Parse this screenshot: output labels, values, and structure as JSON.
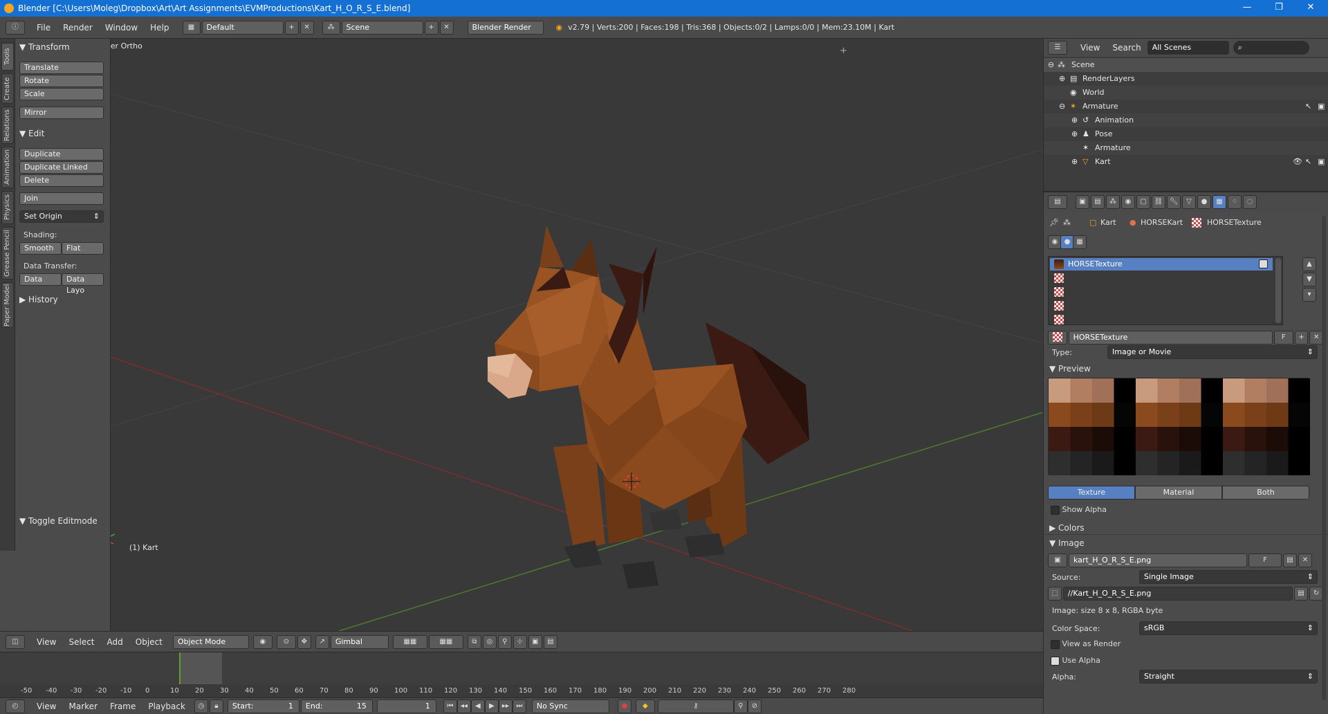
{
  "titlebar": {
    "title": "Blender [C:\\Users\\Moleg\\Dropbox\\Art\\Art Assignments\\EVMProductions\\Kart_H_O_R_S_E.blend]",
    "minimize": "—",
    "maximize": "❐",
    "close": "✕"
  },
  "info": {
    "menus": [
      "File",
      "Render",
      "Window",
      "Help"
    ],
    "layout": "Default",
    "scene": "Scene",
    "engine": "Blender Render",
    "stats": "v2.79 | Verts:200 | Faces:198 | Tris:368 | Objects:0/2 | Lamps:0/0 | Mem:23.10M | Kart"
  },
  "tabs": [
    "Tools",
    "Create",
    "Relations",
    "Animation",
    "Physics",
    "Grease Pencil",
    "Paper Model"
  ],
  "toolshelf": {
    "transform_header": "Transform",
    "translate": "Translate",
    "rotate": "Rotate",
    "scale": "Scale",
    "mirror": "Mirror",
    "edit_header": "Edit",
    "duplicate": "Duplicate",
    "duplicate_linked": "Duplicate Linked",
    "delete": "Delete",
    "join": "Join",
    "set_origin": "Set Origin",
    "shading_label": "Shading:",
    "smooth": "Smooth",
    "flat": "Flat",
    "data_transfer_label": "Data Transfer:",
    "data": "Data",
    "data_layo": "Data Layo",
    "history_header": "History",
    "toggle_editmode": "Toggle Editmode"
  },
  "viewport": {
    "view_label": "User Ortho",
    "object_label": "(1) Kart"
  },
  "view3d_header": {
    "menus": [
      "View",
      "Select",
      "Add",
      "Object"
    ],
    "mode": "Object Mode",
    "orientation": "Gimbal"
  },
  "timeline": {
    "ticks": [
      "-50",
      "-40",
      "-30",
      "-20",
      "-10",
      "0",
      "10",
      "20",
      "30",
      "40",
      "50",
      "60",
      "70",
      "80",
      "90",
      "100",
      "110",
      "120",
      "130",
      "140",
      "150",
      "160",
      "170",
      "180",
      "190",
      "200",
      "210",
      "220",
      "230",
      "240",
      "250",
      "260",
      "270",
      "280"
    ],
    "menus": [
      "View",
      "Marker",
      "Frame",
      "Playback"
    ],
    "start_label": "Start:",
    "start": "1",
    "end_label": "End:",
    "end": "15",
    "current": "1",
    "sync": "No Sync"
  },
  "outliner": {
    "menus": [
      "View",
      "Search"
    ],
    "filter": "All Scenes",
    "rows": [
      "Scene",
      "RenderLayers",
      "World",
      "Armature",
      "Animation",
      "Pose",
      "Armature",
      "Kart"
    ]
  },
  "properties": {
    "breadcrumb": [
      "Kart",
      "HORSEKart",
      "HORSETexture"
    ],
    "slots": [
      "HORSETexture"
    ],
    "texture_name": "HORSETexture",
    "fake_user": "F",
    "type_label": "Type:",
    "type_value": "Image or Movie",
    "preview_header": "Preview",
    "preview_tabs": [
      "Texture",
      "Material",
      "Both"
    ],
    "show_alpha": "Show Alpha",
    "colors_header": "Colors",
    "image_header": "Image",
    "image_name": "kart_H_O_R_S_E.png",
    "source_label": "Source:",
    "source_value": "Single Image",
    "filepath": "//Kart_H_O_R_S_E.png",
    "image_info": "Image: size 8 x 8, RGBA byte",
    "colorspace_label": "Color Space:",
    "colorspace_value": "sRGB",
    "view_as_render": "View as Render",
    "use_alpha": "Use Alpha",
    "alpha_label": "Alpha:",
    "alpha_value": "Straight"
  },
  "colors": {
    "title_bar": "#1570d4",
    "selection": "#5680c2",
    "horse_body": "#8b4a1e",
    "horse_mane": "#3a1a12",
    "muzzle": "#d9a88a",
    "hooves": "#2e2e2e"
  }
}
